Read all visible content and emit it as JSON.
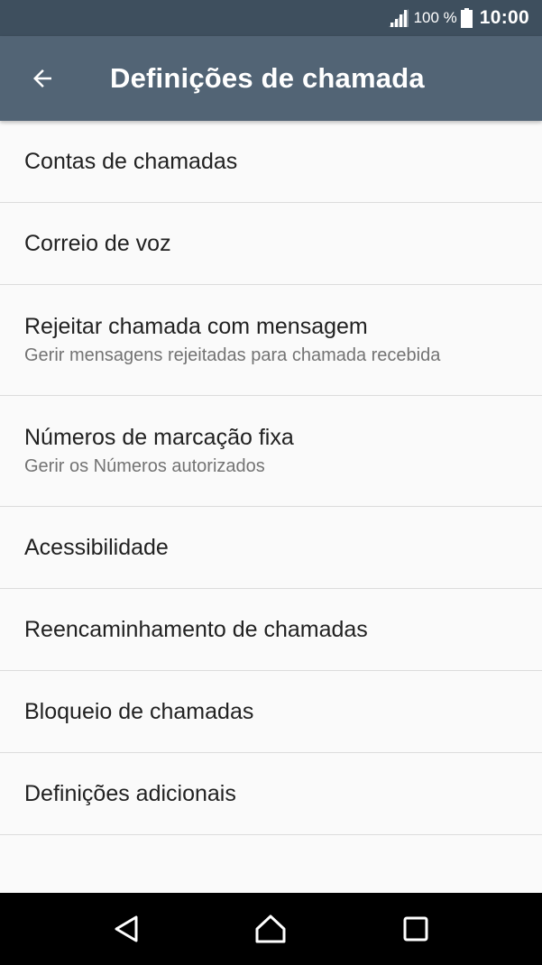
{
  "status_bar": {
    "battery_percent": "100 %",
    "time": "10:00"
  },
  "app_bar": {
    "title": "Definições de chamada"
  },
  "settings": [
    {
      "title": "Contas de chamadas",
      "subtitle": ""
    },
    {
      "title": "Correio de voz",
      "subtitle": ""
    },
    {
      "title": "Rejeitar chamada com mensagem",
      "subtitle": "Gerir mensagens rejeitadas para chamada recebida"
    },
    {
      "title": "Números de marcação fixa",
      "subtitle": "Gerir os Números autorizados"
    },
    {
      "title": "Acessibilidade",
      "subtitle": ""
    },
    {
      "title": "Reencaminhamento de chamadas",
      "subtitle": ""
    },
    {
      "title": "Bloqueio de chamadas",
      "subtitle": ""
    },
    {
      "title": "Definições adicionais",
      "subtitle": ""
    }
  ],
  "icons": {
    "back": "arrow-back-icon",
    "signal": "signal-icon",
    "battery": "battery-icon",
    "nav_back": "triangle-back-icon",
    "nav_home": "home-icon",
    "nav_recents": "square-recents-icon"
  },
  "colors": {
    "status_bar": "#3e4f5e",
    "app_bar": "#526475",
    "background": "#fafafa",
    "divider": "#dcdcdc",
    "nav_bar": "#000000"
  }
}
